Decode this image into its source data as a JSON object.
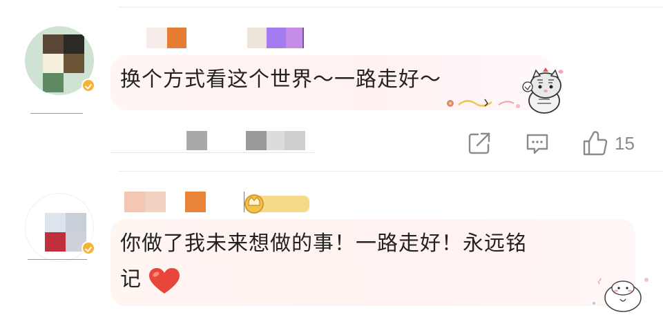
{
  "comments": [
    {
      "text": "换个方式看这个世界～一路走好～",
      "actions": {
        "share_icon": "share-square-icon",
        "comment_icon": "comment-bubble-icon",
        "like_icon": "thumbs-up-icon",
        "like_count": "15"
      },
      "sticker": "cat-sticker"
    },
    {
      "text_line1": "你做了我未来想做的事！一路走好！永远铭",
      "text_line2": "记",
      "emoji": "red-heart",
      "sticker": "bun-sticker"
    }
  ],
  "colors": {
    "accent_badge": "#f5b335",
    "icon_gray": "#8a8a8a",
    "heart_red": "#e8463a"
  }
}
